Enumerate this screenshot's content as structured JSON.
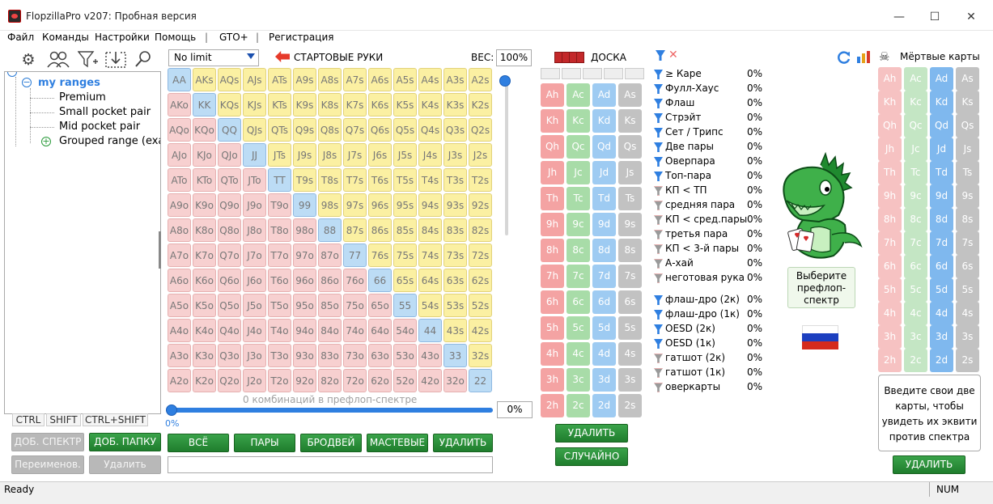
{
  "window": {
    "title": "FlopzillaPro v207: Пробная версия",
    "controls": {
      "minimize": "—",
      "maximize": "☐",
      "close": "✕"
    }
  },
  "menu": [
    "Файл",
    "Команды",
    "Настройки",
    "Помощь",
    "|",
    "GTO+",
    "|",
    "Регистрация"
  ],
  "tree": {
    "root": "my ranges",
    "items": [
      "Premium",
      "Small pocket pair",
      "Mid pocket pair",
      "Grouped range (exar"
    ]
  },
  "modifier_keys": [
    "CTRL",
    "SHIFT",
    "CTRL+SHIFT"
  ],
  "left_buttons": {
    "add_range": "ДОБ. СПЕКТР",
    "add_folder": "ДОБ. ПАПКУ",
    "rename": "Переименов.",
    "delete": "Удалить"
  },
  "range_grid": {
    "limit": "No limit",
    "title": "СТАРТОВЫЕ РУКИ",
    "weight_label": "ВЕС:",
    "weight_value": "100%",
    "ranks": [
      "A",
      "K",
      "Q",
      "J",
      "T",
      "9",
      "8",
      "7",
      "6",
      "5",
      "4",
      "3",
      "2"
    ],
    "combos_label": "0 комбинаций в префлоп-спектре",
    "slider_value": "0%",
    "slider_min": "0%",
    "buttons": [
      "ВСЁ",
      "ПАРЫ",
      "БРОДВЕЙ",
      "МАСТЕВЫЕ",
      "УДАЛИТЬ"
    ]
  },
  "board": {
    "title": "ДОСКА",
    "card_ranks": [
      "A",
      "K",
      "Q",
      "J",
      "T",
      "9",
      "8",
      "7",
      "6",
      "5",
      "4",
      "3",
      "2"
    ],
    "suits": [
      "h",
      "c",
      "d",
      "s"
    ],
    "delete_button": "УДАЛИТЬ",
    "random_button": "СЛУЧАЙНО"
  },
  "hand_ranks": {
    "made": [
      {
        "label": "≥ Каре",
        "pct": "0%",
        "on": true
      },
      {
        "label": "Фулл-Хаус",
        "pct": "0%",
        "on": true
      },
      {
        "label": "Флаш",
        "pct": "0%",
        "on": true
      },
      {
        "label": "Стрэйт",
        "pct": "0%",
        "on": true
      },
      {
        "label": "Сет / Трипс",
        "pct": "0%",
        "on": true
      },
      {
        "label": "Две пары",
        "pct": "0%",
        "on": true
      },
      {
        "label": "Оверпара",
        "pct": "0%",
        "on": true
      },
      {
        "label": "Топ-пара",
        "pct": "0%",
        "on": true
      },
      {
        "label": "КП < ТП",
        "pct": "0%",
        "on": false
      },
      {
        "label": "средняя пара",
        "pct": "0%",
        "on": false
      },
      {
        "label": "КП < сред.пары",
        "pct": "0%",
        "on": false
      },
      {
        "label": "третья пара",
        "pct": "0%",
        "on": false
      },
      {
        "label": "КП < 3-й пары",
        "pct": "0%",
        "on": false
      },
      {
        "label": "А-хай",
        "pct": "0%",
        "on": false
      },
      {
        "label": "неготовая рука",
        "pct": "0%",
        "on": false
      }
    ],
    "draws": [
      {
        "label": "флаш-дро (2к)",
        "pct": "0%",
        "on": true
      },
      {
        "label": "флаш-дро (1к)",
        "pct": "0%",
        "on": true
      },
      {
        "label": "OESD (2к)",
        "pct": "0%",
        "on": true
      },
      {
        "label": "OESD (1к)",
        "pct": "0%",
        "on": true
      },
      {
        "label": "гатшот (2к)",
        "pct": "0%",
        "on": false
      },
      {
        "label": "гатшот (1к)",
        "pct": "0%",
        "on": false
      },
      {
        "label": "оверкарты",
        "pct": "0%",
        "on": false
      }
    ]
  },
  "dino_tip": "Выберите префлоп-спектр",
  "dead_cards": {
    "title": "Мёртвые карты",
    "tip": "Введите свои две карты, чтобы увидеть их эквити против спектра",
    "delete_button": "УДАЛИТЬ"
  },
  "status": {
    "left": "Ready",
    "num": "NUM"
  },
  "colors": {
    "green_button": "#2a8f3a",
    "blue_accent": "#2f7fe0",
    "pair_cell": "#bcdcf5",
    "suited_cell": "#fbf0a2",
    "offsuit_cell": "#f7d0d0"
  }
}
